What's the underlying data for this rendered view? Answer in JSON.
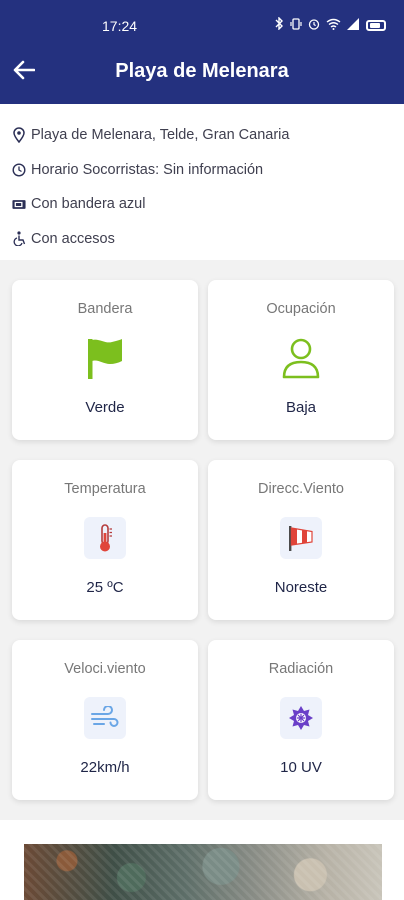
{
  "status_bar": {
    "time": "17:24",
    "icons": [
      "bluetooth-icon",
      "vibrate-icon",
      "alarm-icon",
      "wifi-icon",
      "signal-icon",
      "battery-icon"
    ]
  },
  "header": {
    "title": "Playa de Melenara",
    "back_icon": "arrow-left-icon"
  },
  "info": [
    {
      "icon": "location-pin-icon",
      "text": "Playa de Melenara, Telde, Gran Canaria"
    },
    {
      "icon": "clock-icon",
      "text": "Horario Socorristas: Sin información"
    },
    {
      "icon": "blue-flag-icon",
      "text": "Con bandera azul"
    },
    {
      "icon": "accessibility-icon",
      "text": "Con accesos"
    }
  ],
  "cards": [
    {
      "label": "Bandera",
      "value": "Verde",
      "icon": "flag-icon",
      "color": "#7cbf1e"
    },
    {
      "label": "Ocupación",
      "value": "Baja",
      "icon": "person-icon",
      "color": "#7cbf1e"
    },
    {
      "label": "Temperatura",
      "value": "25 ºC",
      "icon": "thermometer-icon",
      "color": "#e0453a"
    },
    {
      "label": "Direcc.Viento",
      "value": "Noreste",
      "icon": "windsock-icon",
      "color": "#e0453a"
    },
    {
      "label": "Veloci.viento",
      "value": "22km/h",
      "icon": "wind-icon",
      "color": "#6aa6e6"
    },
    {
      "label": "Radiación",
      "value": "10 UV",
      "icon": "uv-sun-icon",
      "color": "#6a3fc8"
    }
  ],
  "colors": {
    "header_bg": "#24317f",
    "page_bg": "#f2f2f2"
  }
}
